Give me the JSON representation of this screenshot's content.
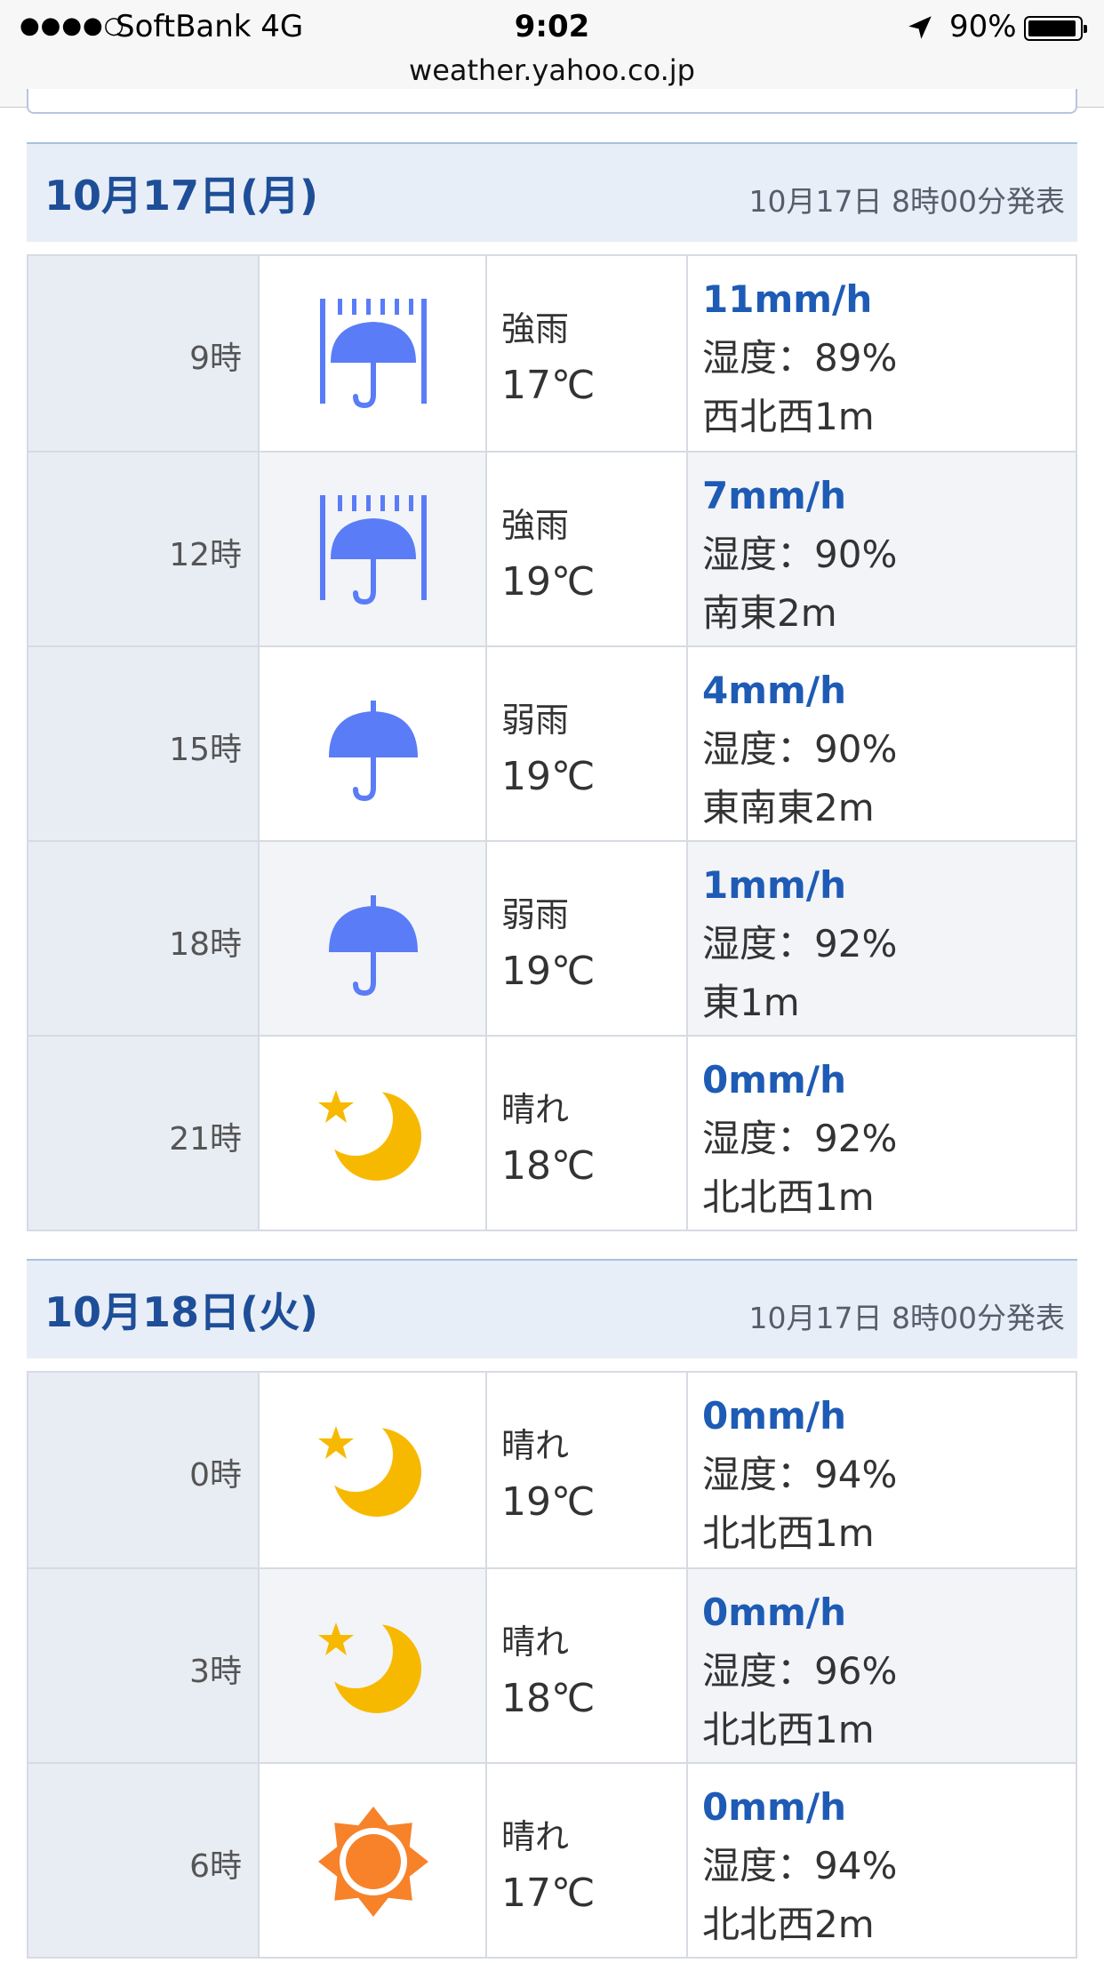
{
  "status_bar": {
    "signal": "●●●●○",
    "carrier": "SoftBank   4G",
    "time": "9:02",
    "battery": "90%",
    "battery_level": 0.9,
    "url": "weather.yahoo.co.jp"
  },
  "days": [
    {
      "title": "10月17日(月)",
      "issued": "10月17日 8時00分発表",
      "rows": [
        {
          "time": "9時",
          "icon": "heavy-rain-icon",
          "weather": "強雨",
          "temp": "17℃",
          "rain": "11mm/h",
          "humidity": "湿度：89%",
          "wind": "西北西1m"
        },
        {
          "time": "12時",
          "icon": "heavy-rain-icon",
          "weather": "強雨",
          "temp": "19℃",
          "rain": "7mm/h",
          "humidity": "湿度：90%",
          "wind": "南東2m"
        },
        {
          "time": "15時",
          "icon": "light-rain-icon",
          "weather": "弱雨",
          "temp": "19℃",
          "rain": "4mm/h",
          "humidity": "湿度：90%",
          "wind": "東南東2m"
        },
        {
          "time": "18時",
          "icon": "light-rain-icon",
          "weather": "弱雨",
          "temp": "19℃",
          "rain": "1mm/h",
          "humidity": "湿度：92%",
          "wind": "東1m"
        },
        {
          "time": "21時",
          "icon": "clear-night-icon",
          "weather": "晴れ",
          "temp": "18℃",
          "rain": "0mm/h",
          "humidity": "湿度：92%",
          "wind": "北北西1m"
        }
      ]
    },
    {
      "title": "10月18日(火)",
      "issued": "10月17日 8時00分発表",
      "rows": [
        {
          "time": "0時",
          "icon": "clear-night-icon",
          "weather": "晴れ",
          "temp": "19℃",
          "rain": "0mm/h",
          "humidity": "湿度：94%",
          "wind": "北北西1m"
        },
        {
          "time": "3時",
          "icon": "clear-night-icon",
          "weather": "晴れ",
          "temp": "18℃",
          "rain": "0mm/h",
          "humidity": "湿度：96%",
          "wind": "北北西1m"
        },
        {
          "time": "6時",
          "icon": "sunny-icon",
          "weather": "晴れ",
          "temp": "17℃",
          "rain": "0mm/h",
          "humidity": "湿度：94%",
          "wind": "北北西2m"
        }
      ]
    }
  ],
  "colors": {
    "accent": "#1e4e98",
    "rain_blue": "#5a7cf7",
    "moon_yellow": "#f7b900",
    "sun_orange": "#f7822a"
  }
}
